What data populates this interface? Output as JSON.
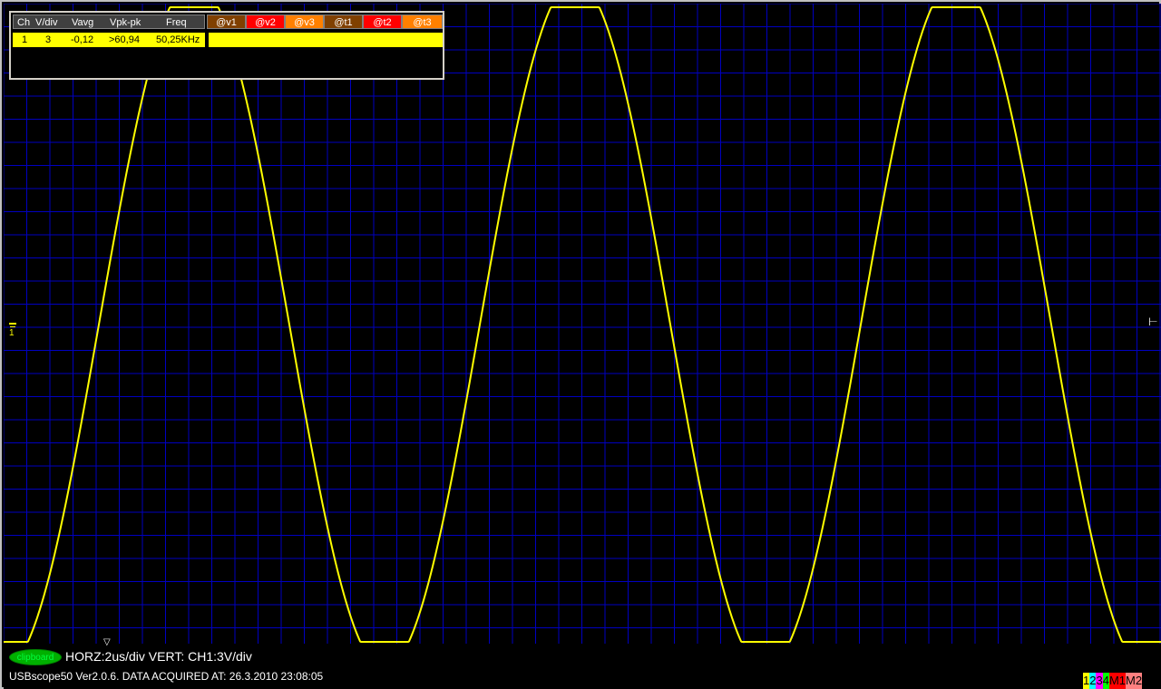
{
  "measurement_table": {
    "headers": [
      "Ch",
      "V/div",
      "Vavg",
      "Vpk-pk",
      "Freq"
    ],
    "cursor_headers": [
      {
        "label": "@v1",
        "bg": "#804000",
        "fg": "#ffffff"
      },
      {
        "label": "@v2",
        "bg": "#ff0000",
        "fg": "#ffffff"
      },
      {
        "label": "@v3",
        "bg": "#ff8000",
        "fg": "#ffffff"
      },
      {
        "label": "@t1",
        "bg": "#804000",
        "fg": "#ffffff"
      },
      {
        "label": "@t2",
        "bg": "#ff0000",
        "fg": "#ffffff"
      },
      {
        "label": "@t3",
        "bg": "#ff8000",
        "fg": "#ffffff"
      }
    ],
    "row": {
      "ch": "1",
      "vdiv": "3",
      "vavg": "-0,12",
      "vpkpk": ">60,94",
      "freq": "50,25KHz"
    }
  },
  "markers": {
    "trigger": "⊢",
    "ch1_ground": "1",
    "hpos": "▽"
  },
  "status": {
    "clipboard_label": "clipboard",
    "horz_vert": "HORZ:2us/div VERT: CH1:3V/div",
    "info": "USBscope50 Ver2.0.6.  DATA ACQUIRED AT: 26.3.2010 23:08:05"
  },
  "channel_toggles": [
    {
      "label": "1",
      "bg": "#ffff00",
      "fg": "#000000"
    },
    {
      "label": "2",
      "bg": "#00ffff",
      "fg": "#000000"
    },
    {
      "label": "3",
      "bg": "#ff00ff",
      "fg": "#000000"
    },
    {
      "label": "4",
      "bg": "#00ff00",
      "fg": "#000000"
    },
    {
      "label": "M1",
      "bg": "#ff0000",
      "fg": "#000000"
    },
    {
      "label": "M2",
      "bg": "#ff8080",
      "fg": "#000000"
    }
  ],
  "colors": {
    "grid": "#0000c0",
    "trace": "#ffff00",
    "background": "#000000"
  },
  "chart_data": {
    "type": "line",
    "series": [
      {
        "name": "1",
        "waveform": "sine",
        "frequency_khz": 50.25,
        "vpkpk_min": 60.94,
        "vavg": -0.12
      }
    ],
    "xlabel": "",
    "ylabel": "",
    "time_per_div_us": 2,
    "volts_per_div": 3,
    "clipped": true,
    "grid": true
  }
}
